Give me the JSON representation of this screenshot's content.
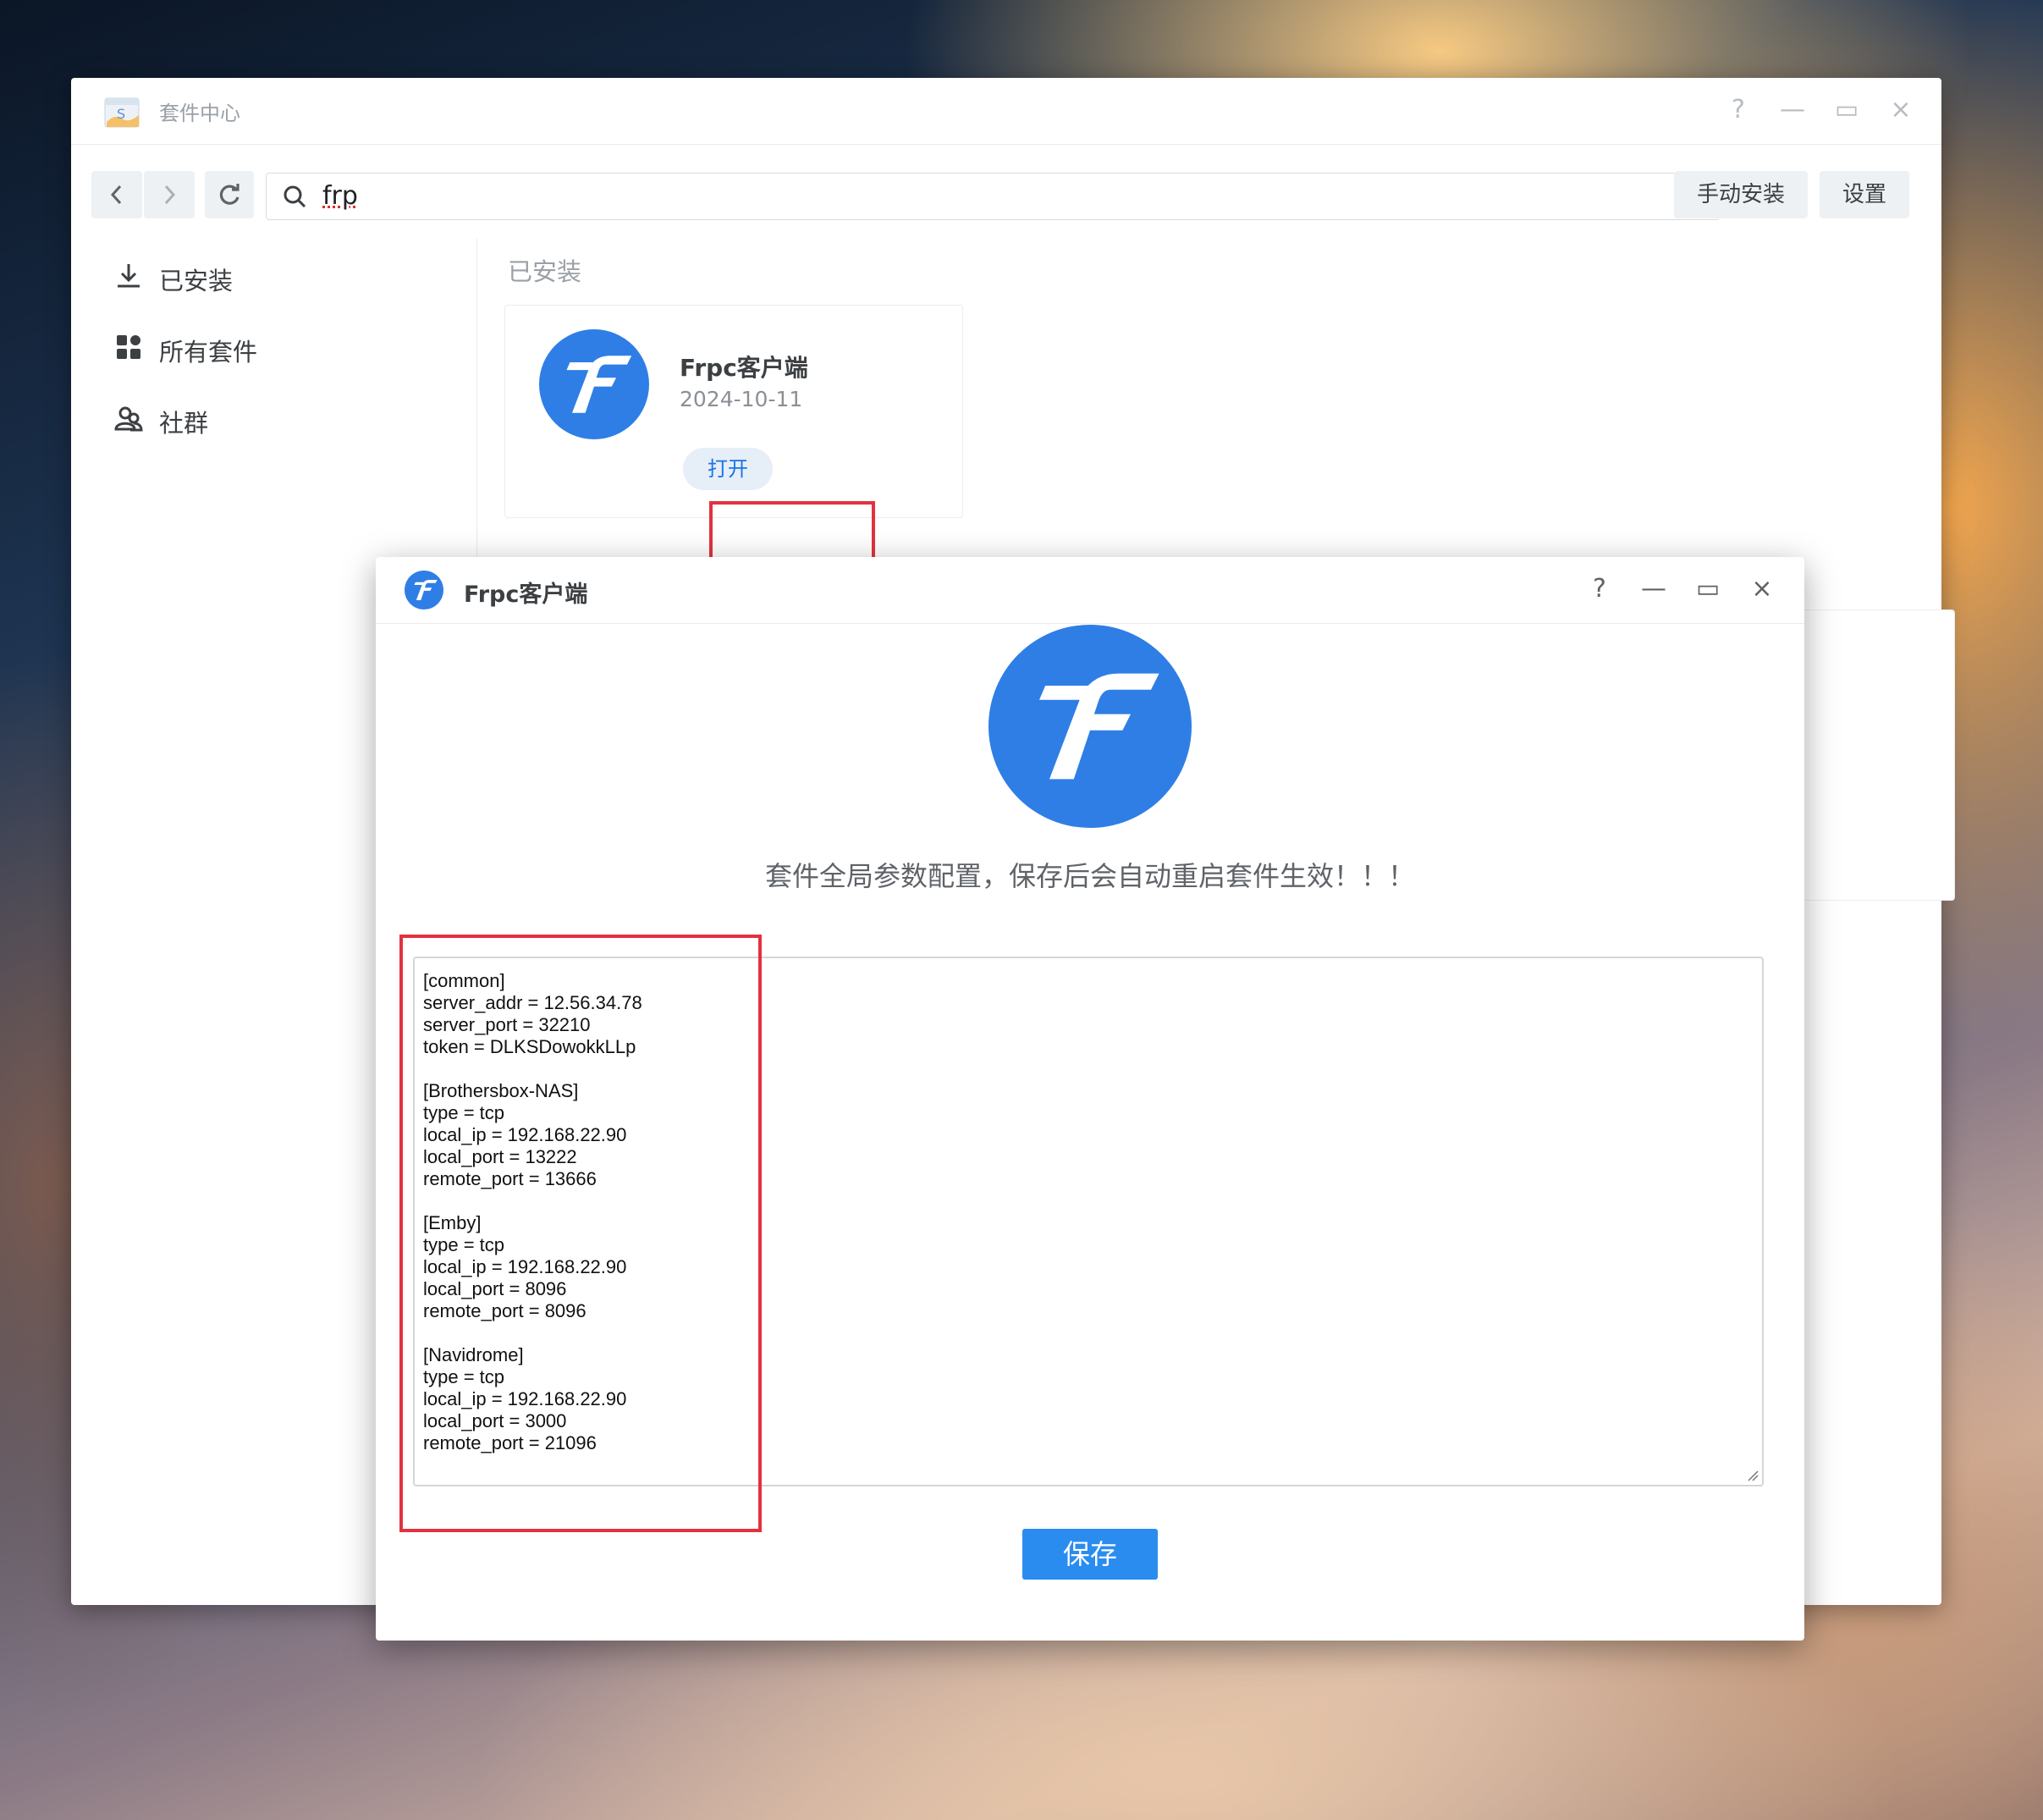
{
  "main_window": {
    "title": "套件中心",
    "controls": {
      "help": "?",
      "minimize": "—",
      "maximize": "▭",
      "close": "×"
    },
    "toolbar": {
      "back_icon": "chevron-left-icon",
      "forward_icon": "chevron-right-icon",
      "refresh_icon": "refresh-icon",
      "search_value": "frp",
      "manual_install": "手动安装",
      "settings": "设置"
    },
    "sidebar": {
      "items": [
        {
          "label": "已安装",
          "icon": "download-icon"
        },
        {
          "label": "所有套件",
          "icon": "grid-icon"
        },
        {
          "label": "社群",
          "icon": "community-icon"
        }
      ]
    },
    "section_title": "已安装",
    "package": {
      "name": "Frpc客户端",
      "date": "2024-10-11",
      "open_label": "打开"
    }
  },
  "dialog": {
    "title": "Frpc客户端",
    "controls": {
      "help": "?",
      "minimize": "—",
      "maximize": "▭",
      "close": "×"
    },
    "notice": "套件全局参数配置，保存后会自动重启套件生效！！！",
    "config_lines": [
      "[common]",
      "server_addr = 12.56.34.78",
      "server_port = 32210",
      "token = DLKSDowokkLLp",
      "",
      "[Brothersbox-NAS]",
      "type = tcp",
      "local_ip = 192.168.22.90",
      "local_port = 13222",
      "remote_port = 13666",
      "",
      "[Emby]",
      "type = tcp",
      "local_ip = 192.168.22.90",
      "local_port = 8096",
      "remote_port = 8096",
      "",
      "[Navidrome]",
      "type = tcp",
      "local_ip = 192.168.22.90",
      "local_port = 3000",
      "remote_port = 21096"
    ],
    "save_label": "保存"
  },
  "colors": {
    "accent": "#2b8cf0",
    "logo_blue": "#2f7ee6",
    "highlight_red": "#e2323f"
  }
}
